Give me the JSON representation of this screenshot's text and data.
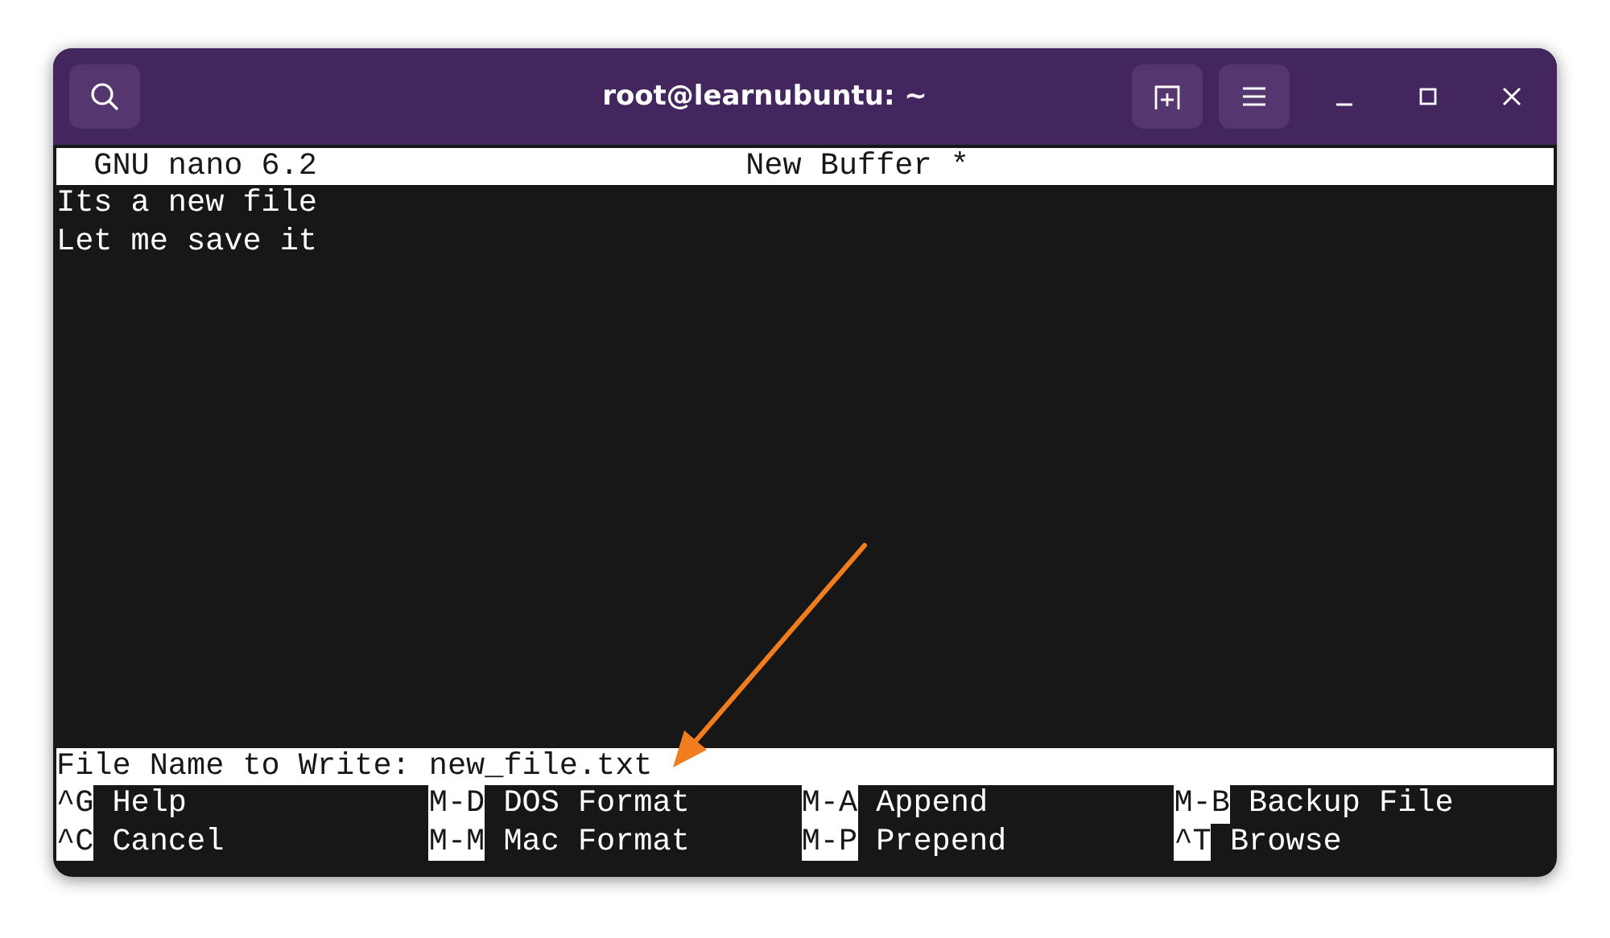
{
  "window": {
    "title": "root@learnubuntu: ~"
  },
  "title_bar": {
    "app": "GNU nano 6.2",
    "buffer": "New Buffer *"
  },
  "buffer_lines": [
    "Its a new file",
    "Let me save it"
  ],
  "prompt": {
    "label": "File Name to Write:",
    "value": "new_file.txt"
  },
  "shortcuts": [
    [
      {
        "key": "^G",
        "label": "Help"
      },
      {
        "key": "M-D",
        "label": "DOS Format"
      },
      {
        "key": "M-A",
        "label": "Append"
      },
      {
        "key": "M-B",
        "label": "Backup File"
      }
    ],
    [
      {
        "key": "^C",
        "label": "Cancel"
      },
      {
        "key": "M-M",
        "label": "Mac Format"
      },
      {
        "key": "M-P",
        "label": "Prepend"
      },
      {
        "key": "^T",
        "label": "Browse"
      }
    ]
  ]
}
